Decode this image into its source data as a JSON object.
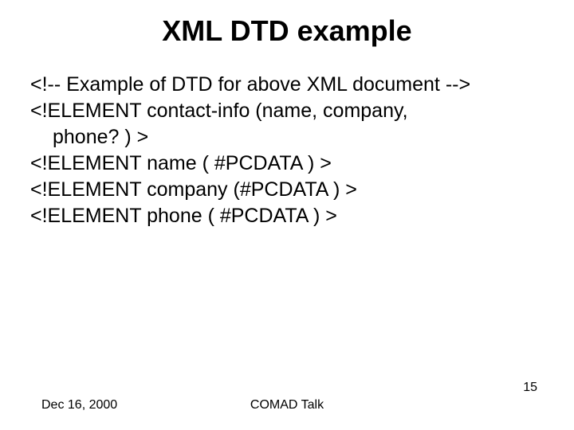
{
  "title": "XML DTD example",
  "lines": {
    "l1": "<!-- Example of DTD for above XML document -->",
    "l2": "<!ELEMENT contact-info (name, company,",
    "l3": "phone? ) >",
    "l4": "<!ELEMENT name  ( #PCDATA ) >",
    "l5": "<!ELEMENT company  (#PCDATA ) >",
    "l6": "<!ELEMENT phone ( #PCDATA ) >"
  },
  "footer": {
    "date": "Dec 16, 2000",
    "center": "COMAD Talk",
    "page": "15"
  }
}
